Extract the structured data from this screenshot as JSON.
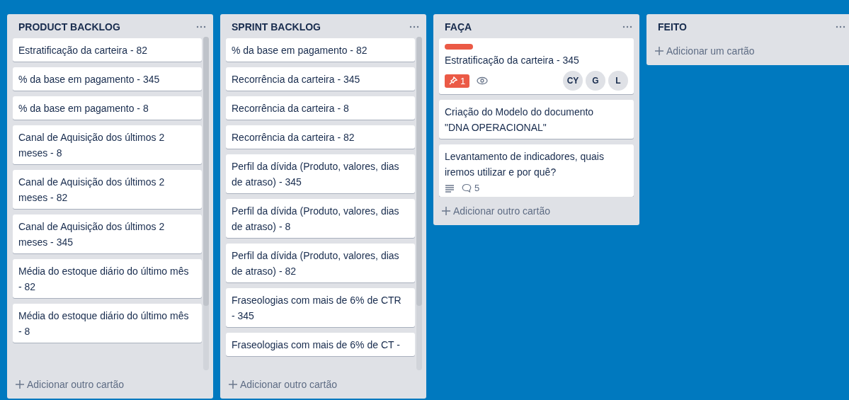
{
  "columns": [
    {
      "title": "PRODUCT BACKLOG",
      "cards": [
        {
          "text": "Estratificação da carteira - 82"
        },
        {
          "text": "% da base em pagamento - 345"
        },
        {
          "text": "% da base em pagamento - 8"
        },
        {
          "text": "Canal de Aquisição dos últimos 2 meses - 8"
        },
        {
          "text": "Canal de Aquisição dos últimos 2 meses - 82"
        },
        {
          "text": "Canal de Aquisição dos últimos 2 meses - 345"
        },
        {
          "text": "Média do estoque diário do último mês - 82"
        },
        {
          "text": "Média do estoque diário do último mês - 8"
        }
      ],
      "add_label": "Adicionar outro cartão"
    },
    {
      "title": "SPRINT BACKLOG",
      "cards": [
        {
          "text": "% da base em pagamento - 82"
        },
        {
          "text": "Recorrência da carteira - 345"
        },
        {
          "text": "Recorrência da carteira - 8"
        },
        {
          "text": "Recorrência da carteira - 82"
        },
        {
          "text": "Perfil da dívida (Produto, valores, dias de atraso) - 345"
        },
        {
          "text": "Perfil da dívida (Produto, valores, dias de atraso) - 8"
        },
        {
          "text": "Perfil da dívida (Produto, valores, dias de atraso) - 82"
        },
        {
          "text": "Fraseologias com mais de 6% de CTR - 345"
        },
        {
          "text": "Fraseologias com mais de 6% de CT -"
        }
      ],
      "add_label": "Adicionar outro cartão"
    },
    {
      "title": "FAÇA",
      "cards": [
        {
          "labels": [
            {
              "color": "#eb5a46"
            }
          ],
          "text": "Estratificação da carteira - 345",
          "badges": [
            {
              "kind": "pin",
              "text": "1"
            },
            {
              "kind": "watch"
            }
          ],
          "members": [
            "CY",
            "G",
            "L"
          ]
        },
        {
          "text": "Criação do Modelo do documento \"DNA OPERACIONAL\""
        },
        {
          "text": "Levantamento de indicadores, quais iremos utilizar e por quê?",
          "badges": [
            {
              "kind": "description"
            },
            {
              "kind": "comments",
              "text": "5"
            }
          ]
        }
      ],
      "add_label": "Adicionar outro cartão"
    },
    {
      "title": "FEITO",
      "add_label": "Adicionar um cartão"
    }
  ]
}
